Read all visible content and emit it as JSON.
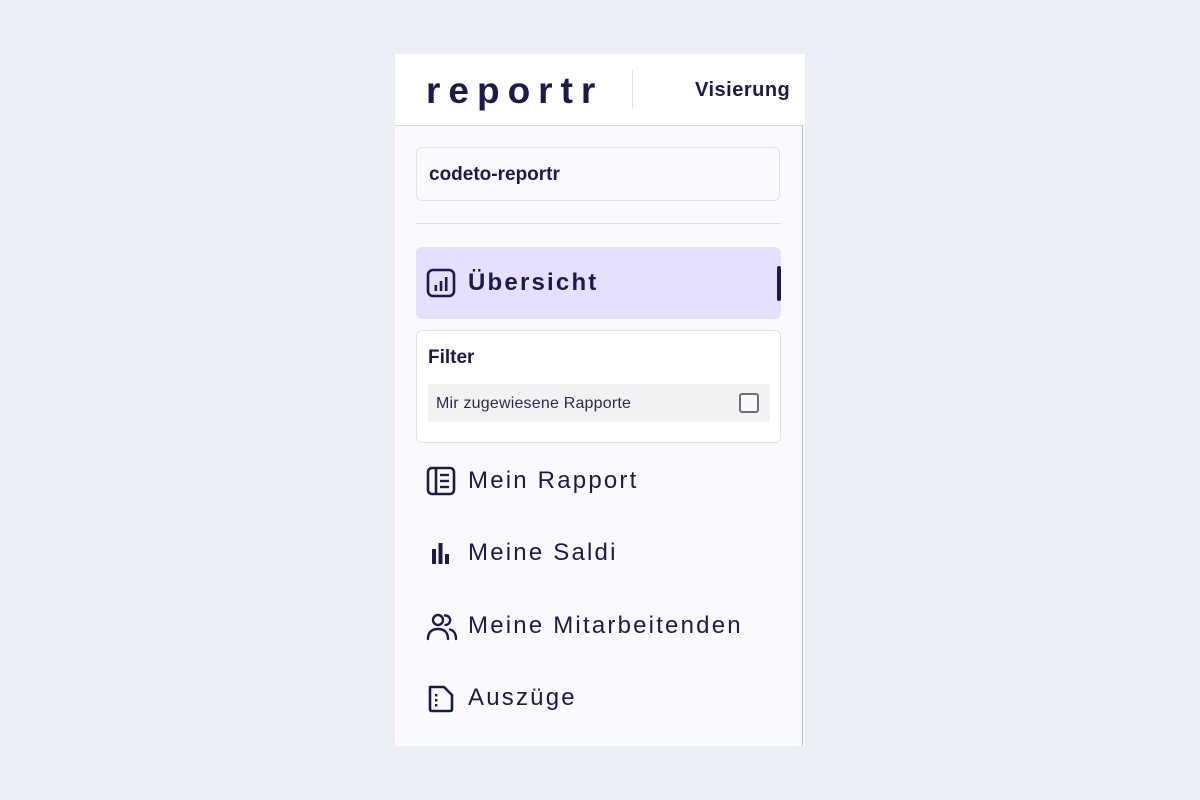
{
  "app": {
    "logo": "reportr",
    "topnav_item": "Visierung"
  },
  "project": {
    "name": "codeto-reportr"
  },
  "nav": {
    "overview": {
      "label": "Übersicht",
      "icon": "chart-square-icon",
      "active": true
    },
    "my_report": {
      "label": "Mein Rapport",
      "icon": "report-list-icon"
    },
    "my_balances": {
      "label": "Meine Saldi",
      "icon": "bar-chart-icon"
    },
    "my_employees": {
      "label": "Meine Mitarbeitenden",
      "icon": "users-icon"
    },
    "extracts": {
      "label": "Auszüge",
      "icon": "document-icon"
    }
  },
  "filter": {
    "title": "Filter",
    "option_label": "Mir zugewiesene Rapporte",
    "option_checked": false
  },
  "colors": {
    "primary": "#1A1A4B",
    "active_bg": "#E6E0FE",
    "page_bg": "#ECEEF5",
    "sidebar_bg": "#FBF9FE"
  }
}
